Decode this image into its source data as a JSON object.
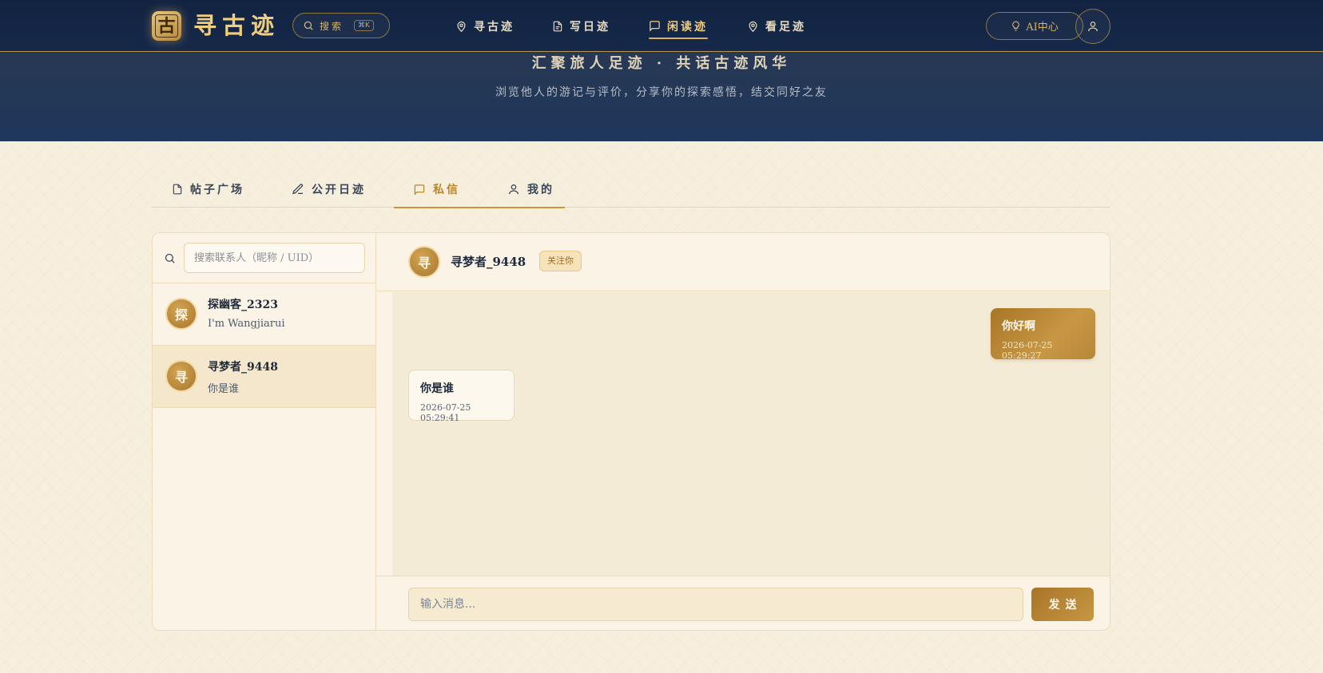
{
  "header": {
    "logo_char": "古",
    "brand": "寻古迹",
    "search_label": "搜索",
    "search_shortcut": "⌘K",
    "nav": [
      {
        "label": "寻古迹",
        "icon": "map-pin-icon"
      },
      {
        "label": "写日迹",
        "icon": "document-icon"
      },
      {
        "label": "闲读迹",
        "icon": "chat-bubble-icon",
        "active": true
      },
      {
        "label": "看足迹",
        "icon": "map-pin-icon"
      }
    ],
    "ai_label": "AI中心",
    "user_icon": "user-icon"
  },
  "hero": {
    "title": "汇聚旅人足迹 · 共话古迹风华",
    "subtitle": "浏览他人的游记与评价，分享你的探索感悟，结交同好之友"
  },
  "tabs": [
    {
      "label": "帖子广场",
      "icon": "document-icon"
    },
    {
      "label": "公开日迹",
      "icon": "pencil-icon"
    },
    {
      "label": "私信",
      "icon": "chat-bubble-icon",
      "active": true
    },
    {
      "label": "我的",
      "icon": "user-icon"
    }
  ],
  "contacts": {
    "search_placeholder": "搜索联系人（昵称 / UID）",
    "items": [
      {
        "avatar": "探",
        "name": "探幽客_2323",
        "preview": "I'm Wangjiarui"
      },
      {
        "avatar": "寻",
        "name": "寻梦者_9448",
        "preview": "你是谁",
        "selected": true
      }
    ]
  },
  "chat": {
    "peer_avatar": "寻",
    "peer_name": "寻梦者_9448",
    "follow_badge": "关注你",
    "messages": [
      {
        "direction": "out",
        "text": "你好啊",
        "time": "2026-07-25 05:29:27"
      },
      {
        "direction": "in",
        "text": "你是谁",
        "time": "2026-07-25 05:29:41"
      }
    ],
    "input_placeholder": "输入消息...",
    "send_label": "发送"
  },
  "colors": {
    "navy": "#122341",
    "gold": "#c9973e",
    "cream": "#f7efdd"
  }
}
